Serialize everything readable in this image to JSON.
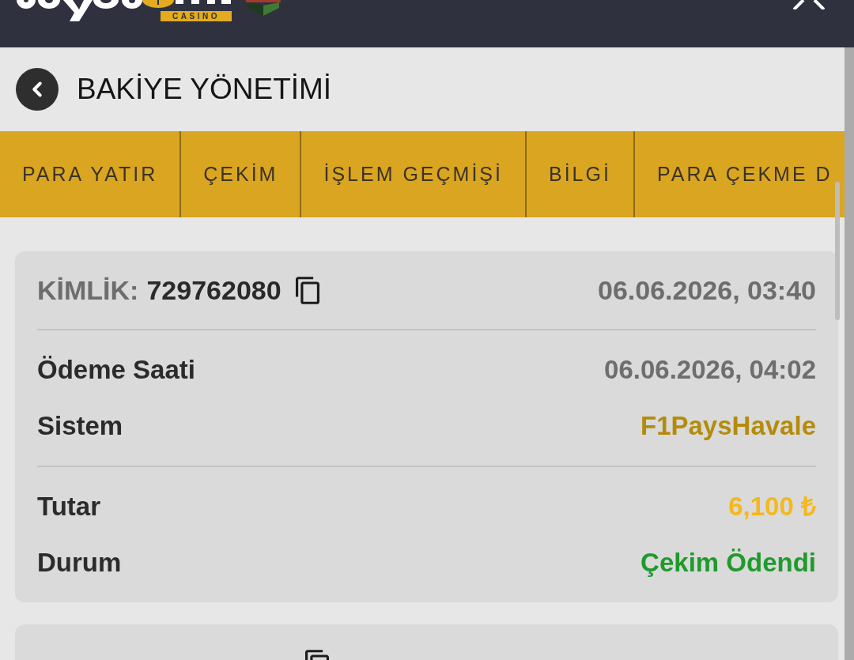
{
  "header": {
    "logo_badge": "CASINO"
  },
  "page": {
    "title": "BAKİYE YÖNETİMİ"
  },
  "tabs": [
    {
      "label": "PARA YATIR",
      "selected": false
    },
    {
      "label": "ÇEKİM",
      "selected": false
    },
    {
      "label": "İŞLEM GEÇMİŞİ",
      "selected": false
    },
    {
      "label": "BİLGİ",
      "selected": false
    },
    {
      "label": "PARA ÇEKME D",
      "selected": false
    }
  ],
  "transactions": [
    {
      "id_label": "KİMLİK:",
      "id": "729762080",
      "copyable": true,
      "created": "06.06.2026, 03:40",
      "sections": [
        {
          "rows": [
            {
              "kind": "datetime",
              "label": "Ödeme Saati",
              "value": "06.06.2026, 04:02"
            },
            {
              "kind": "system",
              "label": "Sistem",
              "value": "F1PaysHavale"
            }
          ]
        },
        {
          "rows": [
            {
              "kind": "amount",
              "label": "Tutar",
              "value": "6,100 ₺"
            },
            {
              "kind": "status",
              "label": "Durum",
              "value": "Çekim Ödendi"
            }
          ]
        }
      ]
    },
    {
      "copyable": true
    }
  ]
}
